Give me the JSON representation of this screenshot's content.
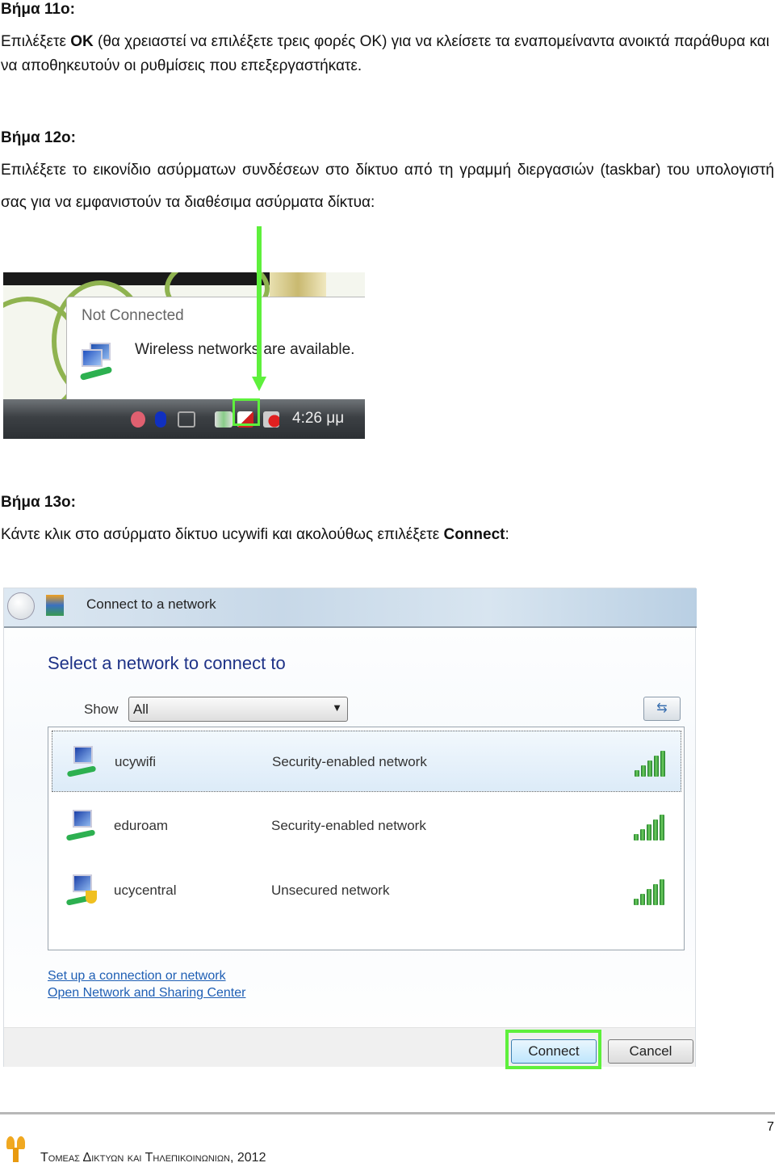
{
  "step11": {
    "heading": "Βήμα 11ο:",
    "text_pre": "Επιλέξετε ",
    "text_bold": "ΟΚ",
    "text_post": " (θα χρειαστεί να επιλέξετε τρεις φορές ΟΚ) για να κλείσετε τα εναπομείναντα ανοικτά παράθυρα και να αποθηκευτούν οι ρυθμίσεις που επεξεργαστήκατε."
  },
  "step12": {
    "heading": "Βήμα 12ο:",
    "text": "Επιλέξετε το εικονίδιο ασύρματων συνδέσεων στο δίκτυο από τη γραμμή διεργασιών (taskbar) του υπολογιστή σας για να εμφανιστούν τα διαθέσιμα ασύρματα δίκτυα:",
    "screenshot": {
      "balloon_title": "Not Connected",
      "balloon_text": "Wireless networks are available.",
      "clock": "4:26 μμ",
      "highlight_color": "#5ef03c",
      "highlighted_icon": "network-status-icon"
    }
  },
  "step13": {
    "heading": "Βήμα 13ο:",
    "text_pre": "Κάντε κλικ στο ασύρματο δίκτυο ucywifi και ακολούθως επιλέξετε ",
    "text_bold": "Connect",
    "text_post": ":"
  },
  "dialog": {
    "title": "Connect to a network",
    "heading": "Select a network to connect to",
    "show_label": "Show",
    "show_value": "All",
    "networks": [
      {
        "name": "ucywifi",
        "description": "Security-enabled network",
        "selected": true,
        "signal_bars": 5
      },
      {
        "name": "eduroam",
        "description": "Security-enabled network",
        "selected": false,
        "signal_bars": 5
      },
      {
        "name": "ucycentral",
        "description": "Unsecured network",
        "selected": false,
        "signal_bars": 5
      }
    ],
    "links": [
      "Set up a connection or network",
      "Open Network and Sharing Center"
    ],
    "connect_label": "Connect",
    "cancel_label": "Cancel",
    "heading_color": "#1e3287",
    "link_color": "#1f5fb4"
  },
  "footer": {
    "page_number": "7",
    "text": "Τομεας Δικτυων και Τηλεπικοινωνιων, 2012"
  }
}
